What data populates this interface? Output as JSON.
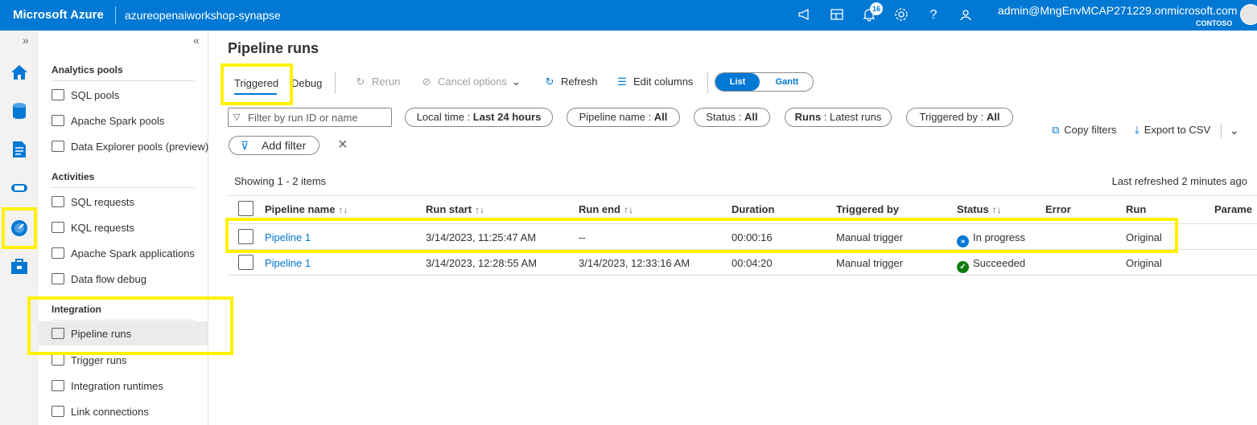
{
  "topbar": {
    "brand": "Microsoft Azure",
    "workspace": "azureopenaiworkshop-synapse",
    "notification_count": "16",
    "user": "admin@MngEnvMCAP271229.onmicrosoft.com",
    "tenant": "CONTOSO",
    "icons": [
      "megaphone-icon",
      "portal-icon",
      "bell-icon",
      "gear-icon",
      "help-icon",
      "feedback-icon"
    ]
  },
  "rail": {
    "items": [
      "home-icon",
      "data-icon",
      "develop-icon",
      "integrate-icon",
      "monitor-icon",
      "manage-icon"
    ]
  },
  "nav": {
    "sections": [
      {
        "heading": "Analytics pools",
        "items": [
          "SQL pools",
          "Apache Spark pools",
          "Data Explorer pools (preview)"
        ]
      },
      {
        "heading": "Activities",
        "items": [
          "SQL requests",
          "KQL requests",
          "Apache Spark applications",
          "Data flow debug"
        ]
      },
      {
        "heading": "Integration",
        "items": [
          "Pipeline runs",
          "Trigger runs",
          "Integration runtimes",
          "Link connections"
        ]
      }
    ]
  },
  "main": {
    "title": "Pipeline runs",
    "tabs": [
      "Triggered",
      "Debug"
    ],
    "toolbar": {
      "rerun": "Rerun",
      "cancel": "Cancel options",
      "refresh": "Refresh",
      "edit_columns": "Edit columns",
      "view_list": "List",
      "view_gantt": "Gantt"
    },
    "filters": {
      "search_placeholder": "Filter by run ID or name",
      "local_time_label": "Local time : ",
      "local_time_value": "Last 24 hours",
      "pipeline_label": "Pipeline name : ",
      "pipeline_value": "All",
      "status_label": "Status : ",
      "status_value": "All",
      "runs_label": "Runs",
      "runs_value": " : Latest runs",
      "trig_label": "Triggered by : ",
      "trig_value": "All",
      "add_filter": "Add filter",
      "copy_filters": "Copy filters",
      "export_csv": "Export to CSV"
    },
    "showing": "Showing 1 - 2 items",
    "last_refreshed": "Last refreshed 2 minutes ago",
    "columns": [
      "Pipeline name",
      "Run start",
      "Run end",
      "Duration",
      "Triggered by",
      "Status",
      "Error",
      "Run",
      "Parame"
    ],
    "rows": [
      {
        "name": "Pipeline 1",
        "run_start": "3/14/2023, 11:25:47 AM",
        "run_end": "--",
        "duration": "00:00:16",
        "triggered_by": "Manual trigger",
        "status": "In progress",
        "error": "",
        "run": "Original"
      },
      {
        "name": "Pipeline 1",
        "run_start": "3/14/2023, 12:28:55 AM",
        "run_end": "3/14/2023, 12:33:16 AM",
        "duration": "00:04:20",
        "triggered_by": "Manual trigger",
        "status": "Succeeded",
        "error": "",
        "run": "Original"
      }
    ],
    "colors": {
      "accent": "#0078d4",
      "success": "#107c10",
      "highlight": "#fff200"
    }
  }
}
